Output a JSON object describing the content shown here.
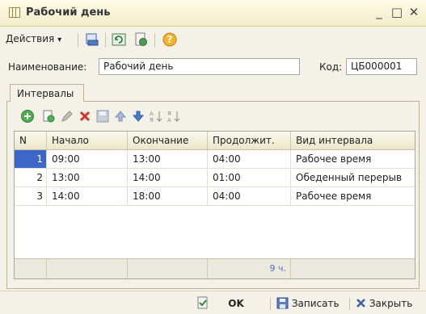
{
  "window": {
    "title": "Рабочий день",
    "minimize": "_",
    "maximize": "□",
    "close": "✕"
  },
  "toolbar": {
    "actions_label": "Действия",
    "actions_arrow": "▾",
    "help": "?"
  },
  "form": {
    "name_label": "Наименование:",
    "name_value": "Рабочий день",
    "code_label": "Код:",
    "code_value": "ЦБ000001"
  },
  "tabs": [
    {
      "label": "Интервалы"
    }
  ],
  "grid": {
    "columns": [
      "N",
      "Начало",
      "Окончание",
      "Продолжит.",
      "Вид интервала"
    ],
    "rows": [
      {
        "n": "1",
        "start": "09:00",
        "end": "13:00",
        "duration": "04:00",
        "kind": "Рабочее время"
      },
      {
        "n": "2",
        "start": "13:00",
        "end": "14:00",
        "duration": "01:00",
        "kind": "Обеденный перерыв"
      },
      {
        "n": "3",
        "start": "14:00",
        "end": "18:00",
        "duration": "04:00",
        "kind": "Рабочее время"
      }
    ],
    "total": "9 ч."
  },
  "buttons": {
    "ok": "OK",
    "save": "Записать",
    "close": "Закрыть"
  },
  "colors": {
    "selection": "#3d67c6",
    "title_bg": "#fffbe7",
    "body_bg": "#f4f2e7"
  }
}
